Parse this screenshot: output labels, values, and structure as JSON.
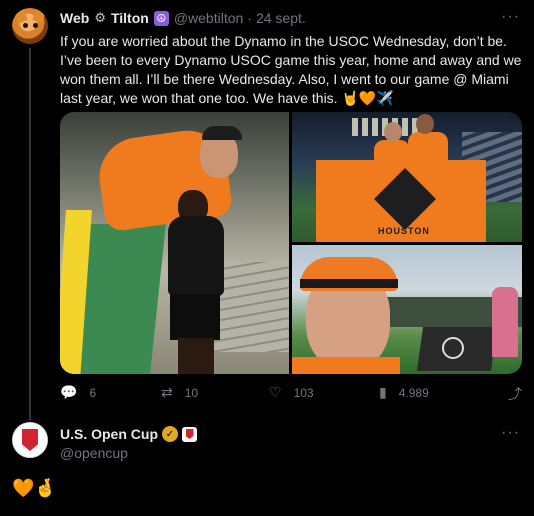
{
  "tweet": {
    "author_name": "Web",
    "author_name_suffix": "Tilton",
    "name_icon": "settings-gear-icon",
    "peace_badge": "☮",
    "handle": "@webtilton",
    "separator": "·",
    "timestamp": "24 sept.",
    "more_label": "···",
    "text": "If you are worried about the Dynamo in the USOC Wednesday, don’t be. I’ve been to every Dynamo USOC game this year, home and away and we won them all. I’ll be there Wednesday. Also, I went to our game @ Miami last year, we won that one too.  We have this. 🤘🧡✈️",
    "media": {
      "photo2_flag_text": "HOUSTON"
    },
    "actions": {
      "replies": "6",
      "retweets": "10",
      "likes": "103",
      "views": "4.989"
    }
  },
  "reply": {
    "author_name": "U.S. Open Cup",
    "verified_mark": "✓",
    "handle": "@opencup",
    "more_label": "···",
    "text": "🧡🤞"
  },
  "colors": {
    "background": "#000000",
    "primary_text": "#e7e9ea",
    "secondary_text": "#71767b",
    "dynamo_orange": "#f07b1f",
    "verified_gold": "#e0a923",
    "opencup_red": "#d1242f"
  }
}
